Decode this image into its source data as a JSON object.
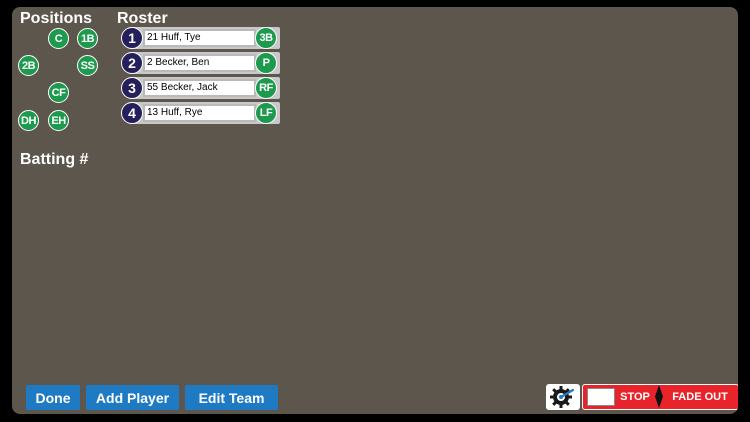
{
  "headings": {
    "positions": "Positions",
    "roster": "Roster",
    "batting": "Batting #"
  },
  "positions": [
    {
      "label": "C"
    },
    {
      "label": "1B"
    },
    {
      "label": "2B"
    },
    {
      "label": "SS"
    },
    {
      "label": "CF"
    },
    {
      "label": "DH"
    },
    {
      "label": "EH"
    }
  ],
  "roster": [
    {
      "order": "1",
      "name": "21 Huff, Tye",
      "position": "3B"
    },
    {
      "order": "2",
      "name": "2 Becker, Ben",
      "position": "P"
    },
    {
      "order": "3",
      "name": "55 Becker, Jack",
      "position": "RF"
    },
    {
      "order": "4",
      "name": "13 Huff, Rye",
      "position": "LF"
    }
  ],
  "buttons": {
    "done": "Done",
    "add_player": "Add Player",
    "edit_team": "Edit Team"
  },
  "audio": {
    "stop": "STOP",
    "fade_out": "FADE OUT",
    "settings_icon": "gear-icon"
  },
  "colors": {
    "background": "#5d564d",
    "position_badge": "#1e9a4e",
    "order_badge": "#23205c",
    "button": "#1f7ac4",
    "audio_bar": "#e8242a"
  }
}
